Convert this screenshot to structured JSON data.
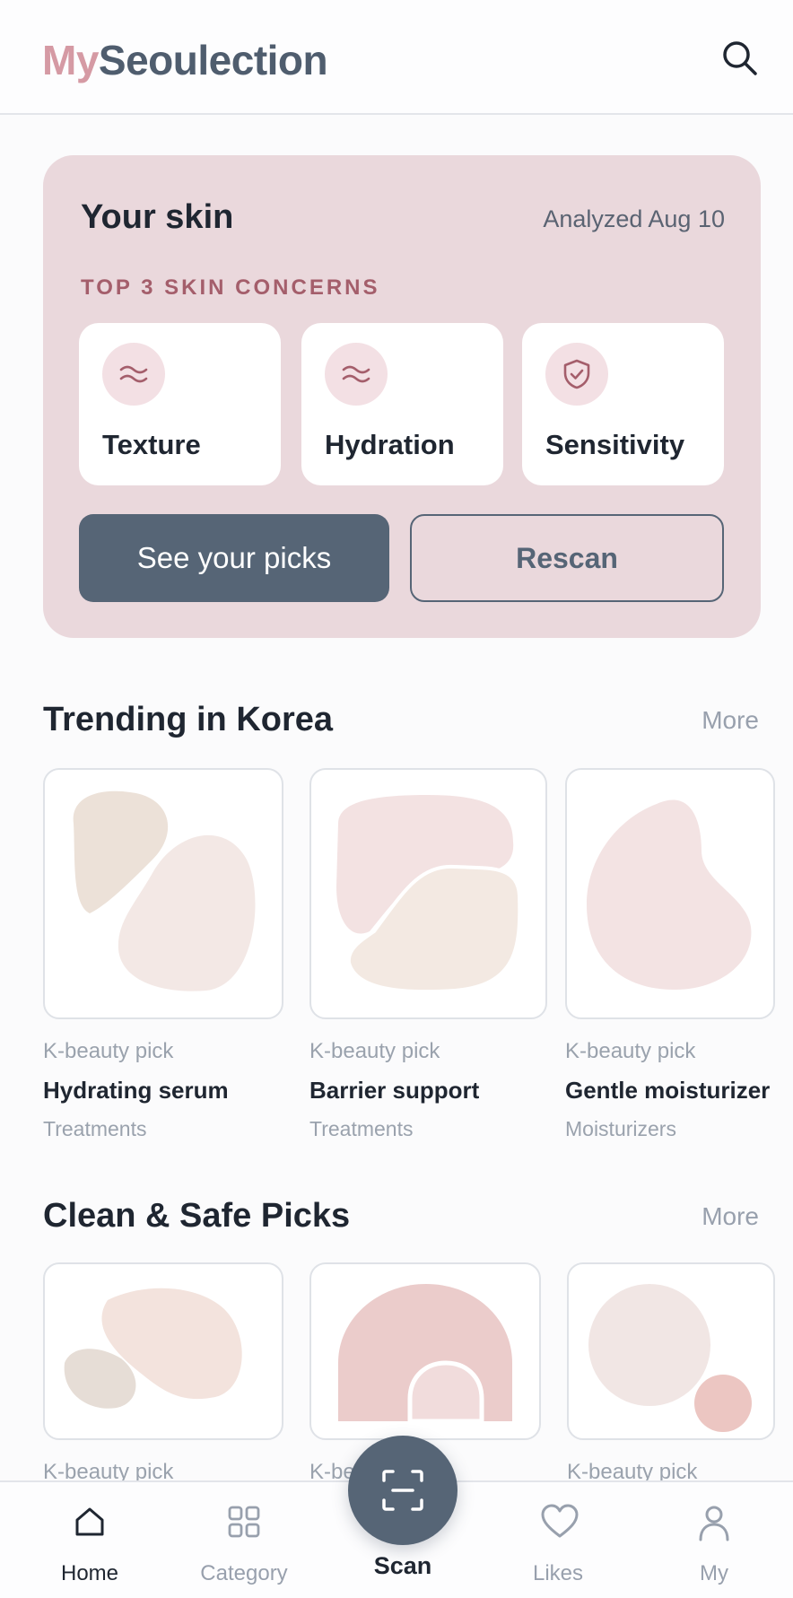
{
  "app": {
    "logo_part1": "My",
    "logo_part2": "Seoulection"
  },
  "skin": {
    "title": "Your skin",
    "date": "Analyzed Aug 10",
    "concerns_label": "TOP 3 SKIN CONCERNS",
    "concerns": [
      {
        "label": "Texture",
        "icon": "texture-icon"
      },
      {
        "label": "Hydration",
        "icon": "hydration-icon"
      },
      {
        "label": "Sensitivity",
        "icon": "shield-check-icon"
      }
    ],
    "primary_button": "See your picks",
    "secondary_button": "Rescan"
  },
  "trending": {
    "title": "Trending in Korea",
    "more": "More",
    "items": [
      {
        "category": "K-beauty pick",
        "name": "Hydrating serum",
        "sub": "Treatments"
      },
      {
        "category": "K-beauty pick",
        "name": "Barrier support",
        "sub": "Treatments"
      },
      {
        "category": "K-beauty pick",
        "name": "Gentle moisturizer",
        "sub": "Moisturizers"
      }
    ]
  },
  "clean": {
    "title": "Clean & Safe Picks",
    "more": "More",
    "items": [
      {
        "category": "K-beauty pick"
      },
      {
        "category": "K-be"
      },
      {
        "category": "K-beauty pick"
      }
    ]
  },
  "nav": {
    "home": "Home",
    "category": "Category",
    "scan": "Scan",
    "likes": "Likes",
    "my": "My"
  },
  "colors": {
    "accent": "#566576",
    "card": "#ead8dc",
    "rose": "#a45e6b"
  }
}
